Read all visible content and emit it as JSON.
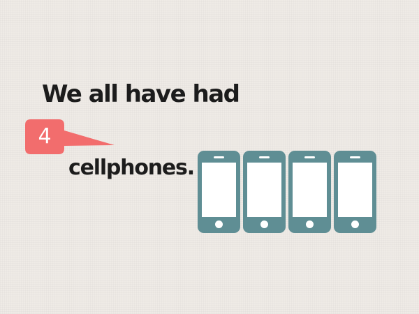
{
  "headline": "We all  have had",
  "callout": {
    "number": "4",
    "color": "#f26d6d"
  },
  "subline": "cellphones.",
  "phones": {
    "count": 4,
    "icon": "smartphone-icon",
    "color": "#5f8e94"
  },
  "background_color": "#efebe6"
}
